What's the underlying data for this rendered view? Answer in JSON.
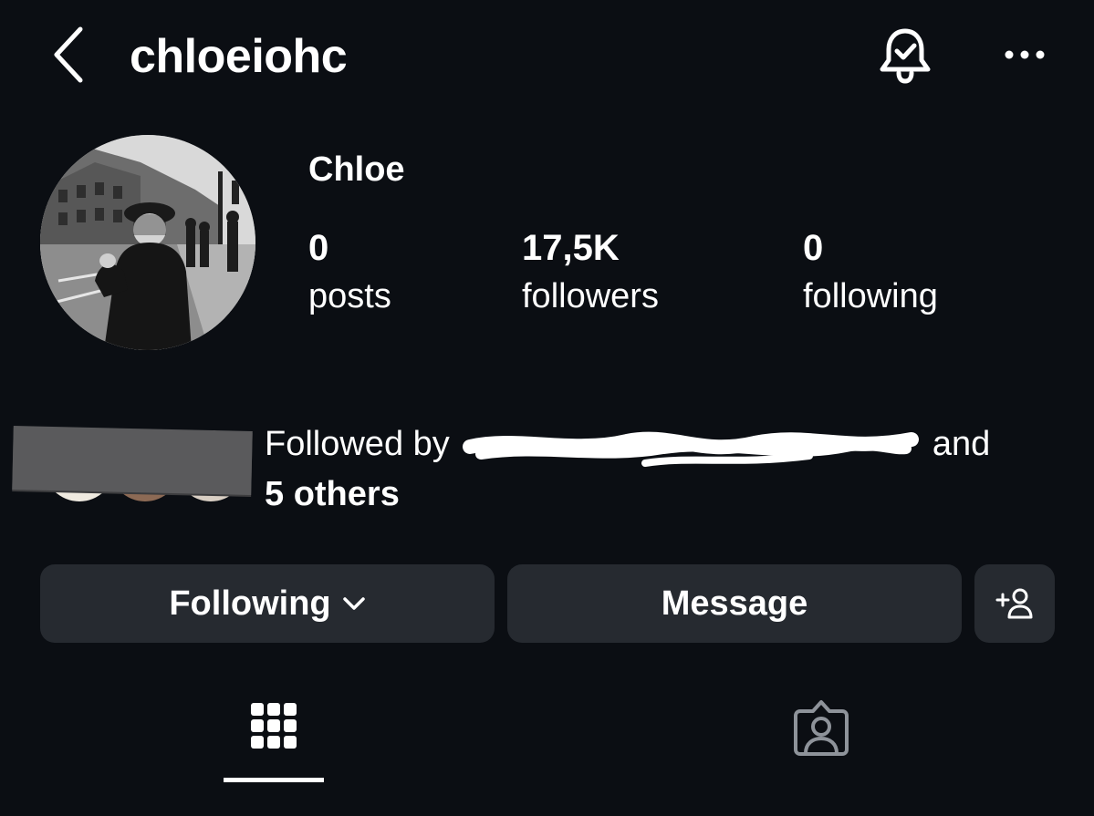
{
  "header": {
    "username": "chloeiohc",
    "back_icon": "chevron-left-icon",
    "bell_icon": "bell-check-icon",
    "more_icon": "more-horizontal-icon"
  },
  "profile": {
    "display_name": "Chloe",
    "avatar": "profile-photo-grayscale-street"
  },
  "stats": {
    "posts": {
      "value": "0",
      "label": "posts"
    },
    "followers": {
      "value": "17,5K",
      "label": "followers"
    },
    "following": {
      "value": "0",
      "label": "following"
    }
  },
  "mutuals": {
    "prefix": "Followed by",
    "suffix": "and",
    "others": "5 others"
  },
  "buttons": {
    "following_label": "Following",
    "message_label": "Message",
    "add_user_icon": "add-user-icon"
  },
  "tabs": {
    "grid_icon": "grid-icon",
    "tagged_icon": "tagged-person-icon",
    "active": "grid"
  },
  "colors": {
    "background": "#0b0e13",
    "button": "#262a30",
    "text": "#ffffff",
    "inactive_icon": "#8e939a"
  }
}
